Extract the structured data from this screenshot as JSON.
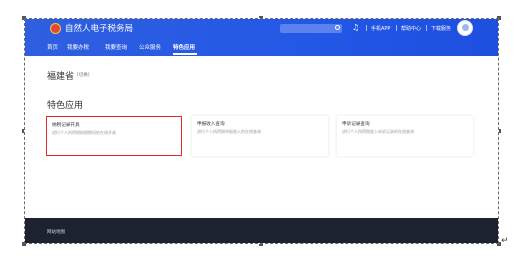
{
  "header": {
    "brand": "自然人电子税务局",
    "nav": [
      "首页",
      "我要办税",
      "我要查询",
      "公众服务",
      "特色应用"
    ],
    "active_nav": "特色应用",
    "links": [
      "手机APP",
      "帮助中心",
      "下载服务"
    ]
  },
  "main": {
    "province": "福建省",
    "switch_label": "[切换]",
    "section_title": "特色应用",
    "cards": [
      {
        "title": "纳税记录开具",
        "desc": "进行个人所得税纳税期间的在线开具"
      },
      {
        "title": "申报收入查询",
        "desc": "进行个人所得税申报收入的在线查询"
      },
      {
        "title": "申诉记录查询",
        "desc": "进行个人所得税收入申诉记录的在线查询"
      }
    ]
  },
  "footer": {
    "sitemap_label": "网站地图"
  },
  "colors": {
    "header_blue": "#2357e6",
    "highlight_red": "#e52a2a",
    "footer_dark": "#1d2230"
  }
}
